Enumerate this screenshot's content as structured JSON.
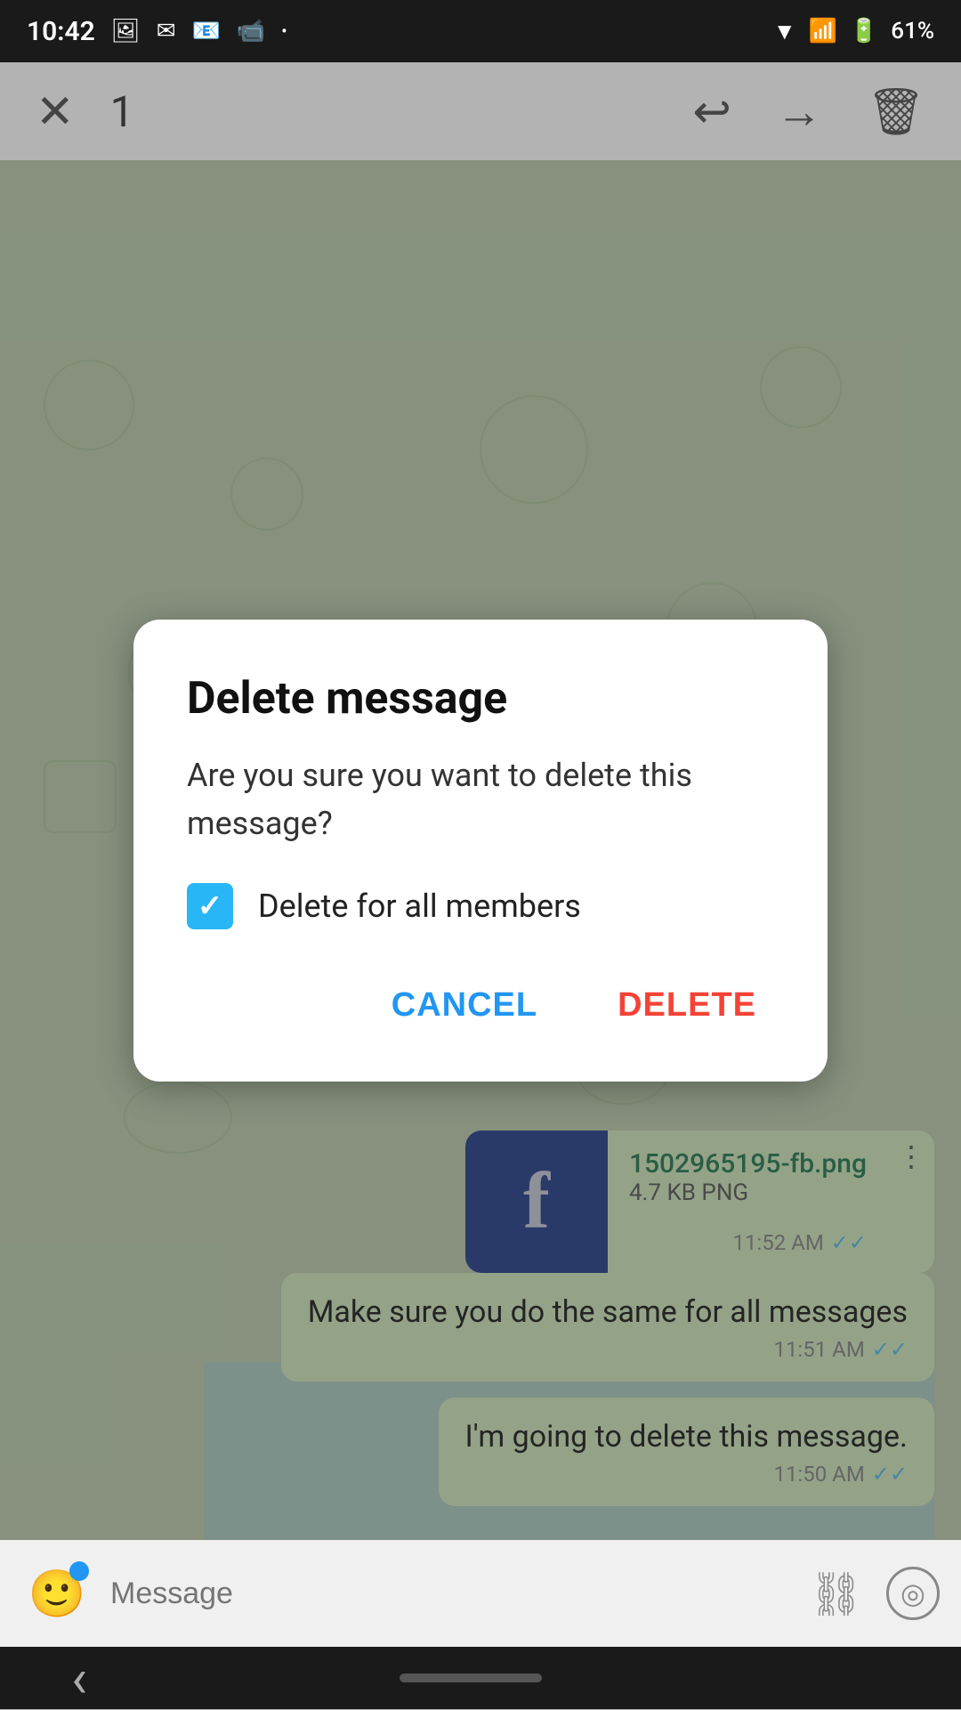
{
  "statusBar": {
    "time": "10:42",
    "battery": "61%"
  },
  "actionBar": {
    "count": "1",
    "closeLabel": "✕"
  },
  "messages": [
    {
      "text": "I'm going to delete this message.",
      "time": "11:50 AM",
      "ticks": "✓✓"
    },
    {
      "text": "Make sure you do the same for all messages",
      "time": "11:51 AM",
      "ticks": "✓✓"
    }
  ],
  "fileMessage": {
    "filename": "1502965195-fb.png",
    "meta": "4.7 KB PNG",
    "time": "11:52 AM",
    "ticks": "✓✓"
  },
  "dialog": {
    "title": "Delete message",
    "body": "Are you sure you want to delete this message?",
    "checkboxLabel": "Delete for all members",
    "checkboxChecked": true,
    "cancelLabel": "CANCEL",
    "deleteLabel": "DELETE"
  },
  "inputArea": {
    "placeholder": "Message"
  },
  "icons": {
    "close": "✕",
    "replyBack": "↩",
    "replyForward": "→",
    "trash": "🗑",
    "emoji": "🙂",
    "paperclip": "📎",
    "camera": "⊙",
    "backArrow": "‹"
  }
}
